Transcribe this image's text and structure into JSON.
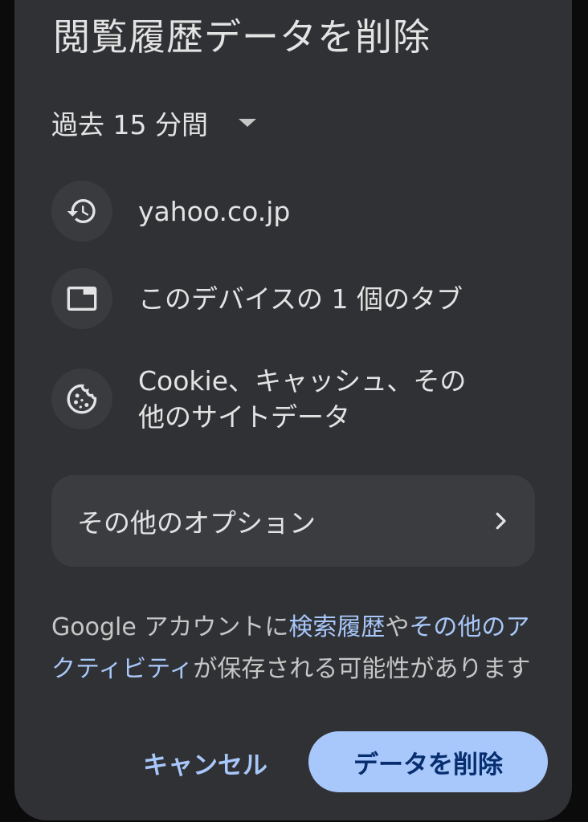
{
  "dialog": {
    "title": "閲覧履歴データを削除",
    "time_range": {
      "selected": "過去 15 分間"
    },
    "items": [
      {
        "icon": "history-icon",
        "text": "yahoo.co.jp"
      },
      {
        "icon": "tab-icon",
        "text": "このデバイスの 1 個のタブ"
      },
      {
        "icon": "cookie-icon",
        "text_line1": "Cookie、キャッシュ、その",
        "text_line2": "他のサイトデータ"
      }
    ],
    "more_options": {
      "label": "その他のオプション",
      "icon": "chevron-right-icon"
    },
    "info": {
      "prefix": "Google アカウントに",
      "link1": "検索履歴",
      "middle": "や",
      "link2": "その他のアクティビティ",
      "suffix": "が保存される可能性があります"
    },
    "buttons": {
      "cancel": "キャンセル",
      "delete": "データを削除"
    }
  },
  "colors": {
    "sheet_background": "#303134",
    "accent": "#a8c7fa",
    "primary_button_text": "#062e6f"
  }
}
